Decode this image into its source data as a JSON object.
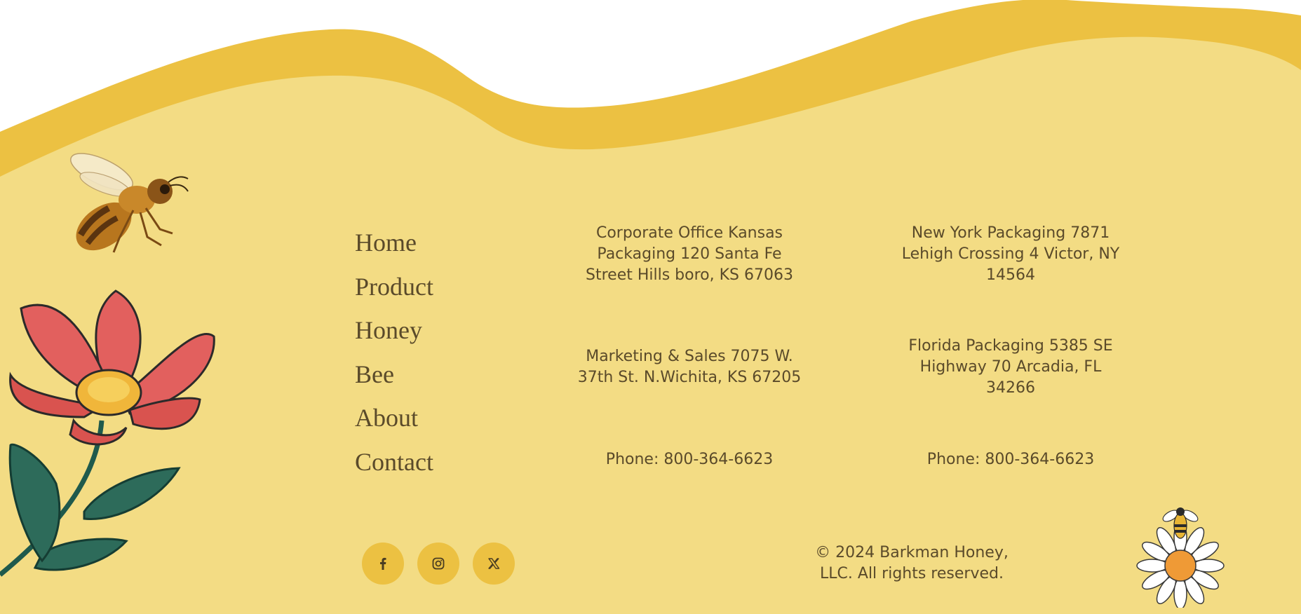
{
  "nav": {
    "items": [
      {
        "label": "Home"
      },
      {
        "label": "Product"
      },
      {
        "label": "Honey"
      },
      {
        "label": "Bee"
      },
      {
        "label": "About"
      },
      {
        "label": "Contact"
      }
    ]
  },
  "offices": {
    "corporate": "Corporate Office Kansas Packaging 120 Santa Fe Street Hills boro, KS 67063",
    "new_york": "New York Packaging 7871 Lehigh Crossing 4 Victor, NY 14564",
    "marketing": "Marketing & Sales 7075 W. 37th St. N.Wichita, KS 67205",
    "florida": "Florida Packaging 5385 SE Highway 70 Arcadia, FL 34266",
    "phone_left": "Phone: 800-364-6623",
    "phone_right": "Phone: 800-364-6623"
  },
  "social": [
    {
      "icon": "facebook-icon"
    },
    {
      "icon": "instagram-icon"
    },
    {
      "icon": "x-twitter-icon"
    }
  ],
  "copyright": "© 2024 Barkman Honey, LLC. All rights reserved.",
  "colors": {
    "background_light": "#f3dc84",
    "wave_accent": "#ecc142",
    "text": "#5a4a2a",
    "social_button": "#ecc142"
  }
}
